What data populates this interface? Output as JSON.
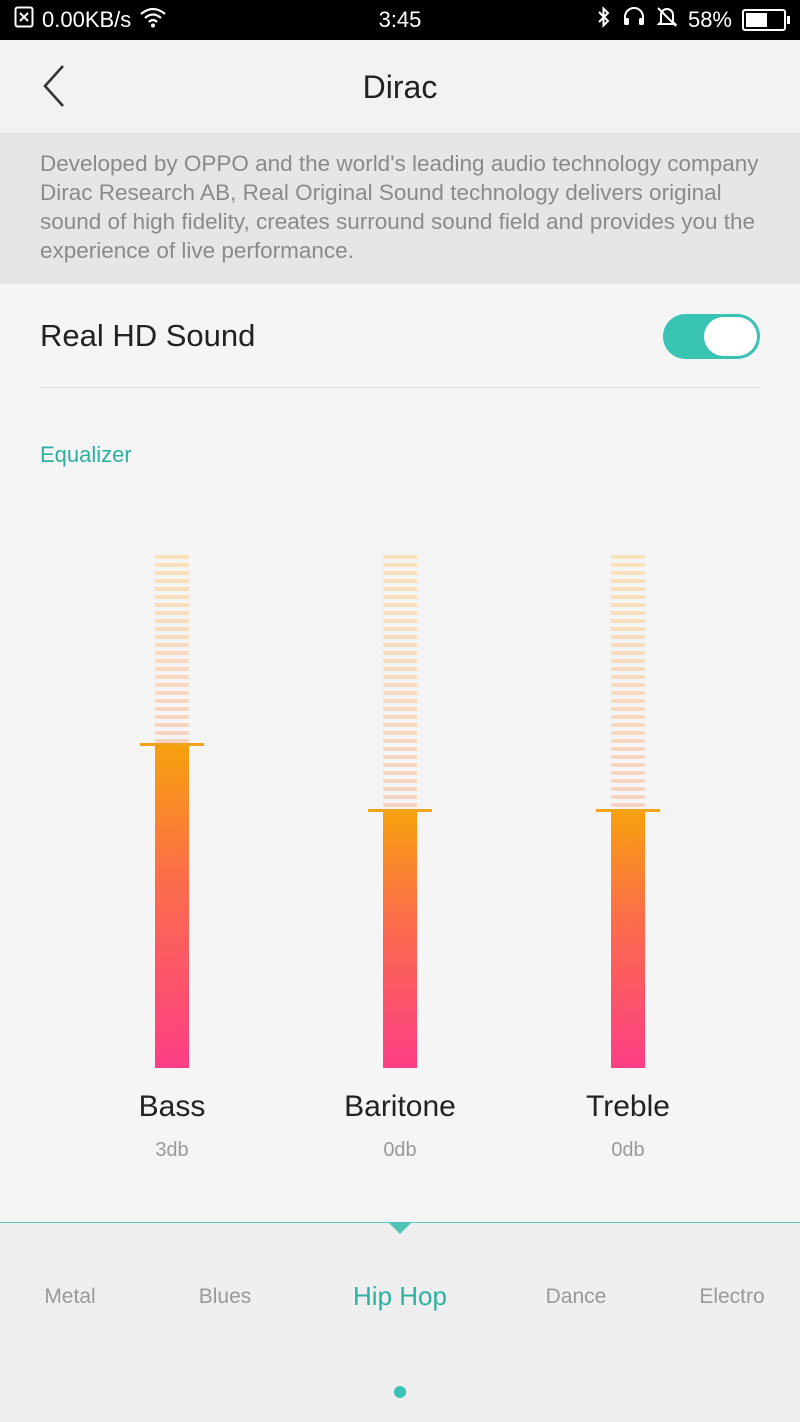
{
  "status_bar": {
    "network_speed": "0.00KB/s",
    "time": "3:45",
    "battery_percent": "58%",
    "battery_level": 0.58,
    "icons": [
      "no-sim-icon",
      "wifi-icon",
      "bluetooth-icon",
      "headset-icon",
      "mute-bell-icon",
      "battery-icon"
    ]
  },
  "header": {
    "title": "Dirac",
    "back_icon": "chevron-left-icon"
  },
  "description": "Developed by OPPO and the world's leading audio technology company Dirac Research AB, Real Original Sound technology delivers original sound of high fidelity, creates surround sound field and provides you the experience of live performance.",
  "real_hd_sound": {
    "label": "Real HD Sound",
    "enabled": true
  },
  "equalizer": {
    "label": "Equalizer",
    "bands": [
      {
        "name": "Bass",
        "value": "3db",
        "level": 0.63
      },
      {
        "name": "Baritone",
        "value": "0db",
        "level": 0.5
      },
      {
        "name": "Treble",
        "value": "0db",
        "level": 0.5
      }
    ]
  },
  "presets": {
    "items": [
      "Metal",
      "Blues",
      "Hip Hop",
      "Dance",
      "Electro"
    ],
    "selected": "Hip Hop"
  },
  "colors": {
    "accent": "#39c3b3",
    "accent_text": "#2db0a1",
    "eq_gradient_top": "#f7a10d",
    "eq_gradient_bottom": "#fd3e86"
  }
}
